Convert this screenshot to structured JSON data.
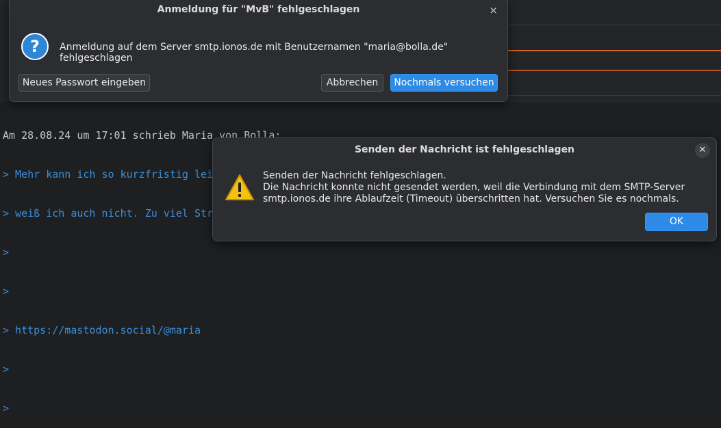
{
  "compose": {
    "quote_header": "Am 28.08.24 um 17:01 schrieb Maria von Bolla:",
    "quote_lines": [
      "> Mehr kann ich so kurzfristig leider nicht tun - und ob ich kommen kann",
      "> weiß ich auch nicht. Zu viel Stress",
      ">",
      ">",
      "> https://mastodon.social/@maria",
      ">",
      ">"
    ]
  },
  "login_dialog": {
    "title": "Anmeldung für \"MvB\" fehlgeschlagen",
    "close_glyph": "×",
    "icon": "question-icon",
    "message": "Anmeldung auf dem Server smtp.ionos.de mit Benutzernamen \"maria@bolla.de\" fehlgeschlagen",
    "new_password_button": "Neues Passwort eingeben",
    "cancel_button": "Abbrechen",
    "retry_button": "Nochmals versuchen"
  },
  "send_error_dialog": {
    "title": "Senden der Nachricht ist fehlgeschlagen",
    "close_glyph": "✕",
    "icon": "warning-icon",
    "message_line1": "Senden der Nachricht fehlgeschlagen.",
    "message_line2": "Die Nachricht konnte nicht gesendet werden, weil die Verbindung mit dem SMTP-Server",
    "message_line3": "smtp.ionos.de ihre Ablaufzeit (Timeout) überschritten hat. Versuchen Sie es nochmals.",
    "ok_button": "OK"
  },
  "colors": {
    "primary_button": "#2d8ae6",
    "quote_text": "#3b8fd9",
    "warning_yellow": "#f5c211"
  }
}
